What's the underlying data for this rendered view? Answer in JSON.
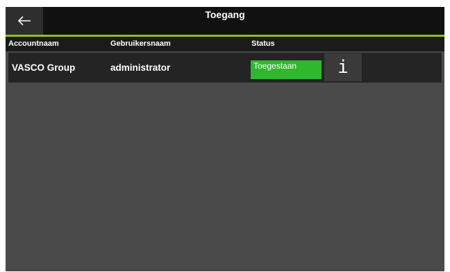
{
  "header": {
    "title": "Toegang",
    "back_icon": "arrow-left-icon"
  },
  "colors": {
    "accent": "#8fbf1a",
    "status_allowed": "#2eb82e",
    "background": "#4a4a4a",
    "titlebar": "#111111"
  },
  "table": {
    "columns": [
      "Accountnaam",
      "Gebruikersnaam",
      "Status"
    ],
    "rows": [
      {
        "account": "VASCO Group",
        "username": "administrator",
        "status": "Toegestaan",
        "info_icon": "info-icon",
        "info_glyph": "i"
      }
    ]
  }
}
